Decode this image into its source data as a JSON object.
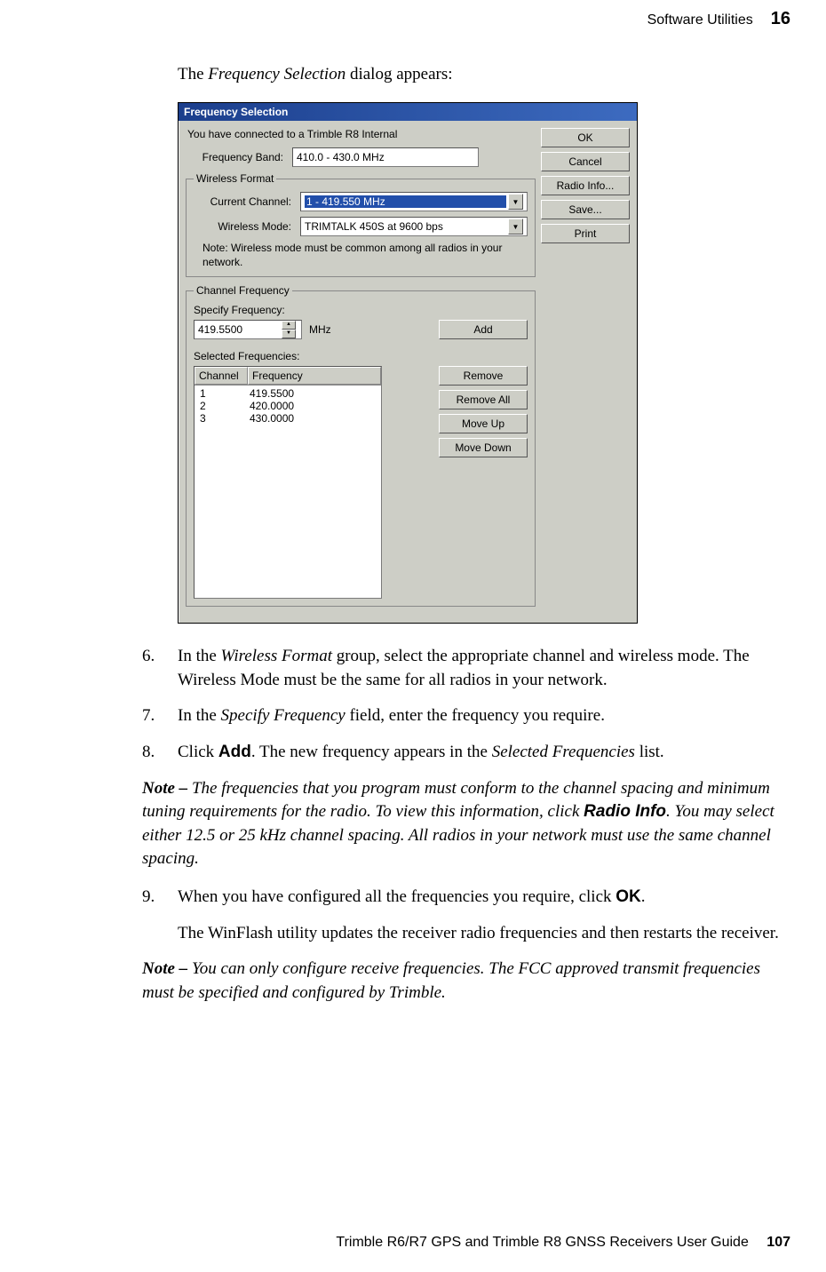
{
  "header": {
    "section": "Software Utilities",
    "chapter": "16"
  },
  "intro": {
    "before": "The ",
    "italic": "Frequency Selection",
    "after": " dialog appears:"
  },
  "dialog": {
    "title": "Frequency Selection",
    "connected_line": "You have connected to a Trimble R8 Internal",
    "freq_band": {
      "label": "Frequency Band:",
      "value": "410.0 - 430.0 MHz"
    },
    "wireless_group": {
      "legend": "Wireless Format",
      "current_channel": {
        "label": "Current Channel:",
        "value": "1 - 419.550 MHz"
      },
      "wireless_mode": {
        "label": "Wireless Mode:",
        "value": "TRIMTALK 450S at 9600 bps"
      },
      "note": "Note: Wireless mode must be common among all radios in your network."
    },
    "channel_group": {
      "legend": "Channel Frequency",
      "specify_label": "Specify Frequency:",
      "specify_value": "419.5500",
      "unit": "MHz",
      "add_label": "Add",
      "selected_label": "Selected Frequencies:",
      "columns": {
        "channel": "Channel",
        "frequency": "Frequency"
      },
      "rows": [
        {
          "ch": "1",
          "freq": "419.5500"
        },
        {
          "ch": "2",
          "freq": "420.0000"
        },
        {
          "ch": "3",
          "freq": "430.0000"
        }
      ],
      "remove_label": "Remove",
      "remove_all_label": "Remove All",
      "move_up_label": "Move Up",
      "move_down_label": "Move Down"
    },
    "side_buttons": {
      "ok": "OK",
      "cancel": "Cancel",
      "radio_info": "Radio Info...",
      "save": "Save...",
      "print": "Print"
    }
  },
  "steps": {
    "s6": {
      "num": "6.",
      "before": "In the ",
      "italic": "Wireless Format",
      "after": " group, select the appropriate channel and wireless mode. The Wireless Mode must be the same for all radios in your network."
    },
    "s7": {
      "num": "7.",
      "before": "In the ",
      "italic": "Specify Frequency",
      "after": " field, enter the frequency you require."
    },
    "s8": {
      "num": "8.",
      "before": "Click ",
      "bold": "Add",
      "mid": ". The new frequency appears in the ",
      "italic": "Selected Frequencies",
      "after": " list."
    },
    "s9": {
      "num": "9.",
      "before": "When you have configured all the frequencies you require, click ",
      "bold": "OK",
      "after": "."
    },
    "s9b": "The WinFlash utility updates the receiver radio frequencies and then restarts the receiver."
  },
  "note1": {
    "lead": "Note – ",
    "t1": "The frequencies that you program must conform to the channel spacing and minimum tuning requirements for the radio. To view this information, click ",
    "bold": "Radio Info",
    "t2": ". You may select either 12.5 or 25 kHz channel spacing. All radios in your network must use the same channel spacing."
  },
  "note2": {
    "lead": "Note – ",
    "t1": "You can only configure receive frequencies. The FCC approved transmit frequencies must be specified and configured by Trimble."
  },
  "footer": {
    "title": "Trimble R6/R7 GPS and Trimble R8 GNSS Receivers User Guide",
    "page": "107"
  }
}
